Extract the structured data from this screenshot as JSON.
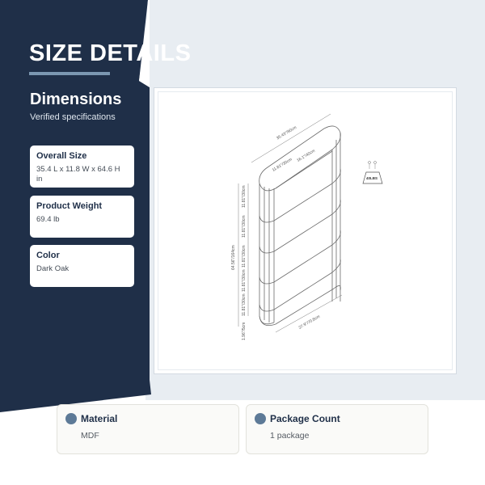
{
  "header": {
    "title": "SIZE DETAILS",
    "section_title": "Dimensions",
    "section_subtitle": "Verified specifications"
  },
  "specs": [
    {
      "label": "Overall Size",
      "value": "35.4 L x 11.8 W x 64.6 H in"
    },
    {
      "label": "Product Weight",
      "value": "69.4 lb"
    },
    {
      "label": "Color",
      "value": "Dark Oak"
    }
  ],
  "diagram": {
    "top_length": "35.43\"/90cm",
    "inner_length": "16.1\"/40cm",
    "depth": "11.81\"/30cm",
    "total_height": "64.56\"/164cm",
    "shelf_gap_1": "11.81\"/30cm",
    "shelf_gap_2": "11.81\"/30cm",
    "shelf_gap_3": "11.81\"/30cm",
    "shelf_gap_4": "11.81\"/30cm",
    "shelf_gap_5": "11.81\"/30cm",
    "base_height": "1.96\"/5cm",
    "bottom_length": "27.9\"/70.8cm",
    "load_capacity": "40LBS"
  },
  "bottom_cards": [
    {
      "label": "Material",
      "value": "MDF"
    },
    {
      "label": "Package Count",
      "value": "1 package"
    }
  ],
  "colors": {
    "navy": "#1f2f48",
    "light_band": "#e8edf2",
    "accent": "#7b97b1",
    "dot": "#5d7a97"
  }
}
